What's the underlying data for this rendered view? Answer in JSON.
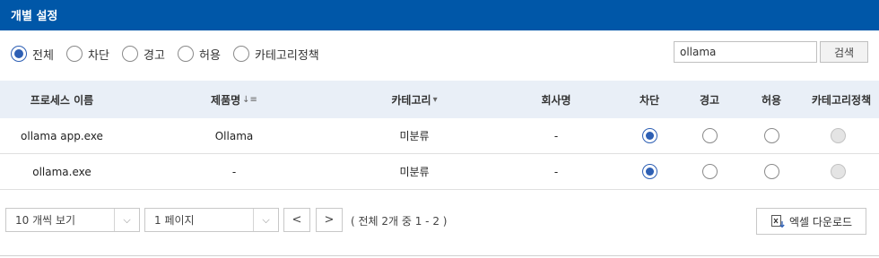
{
  "header": {
    "title": "개별 설정"
  },
  "filters": {
    "options": [
      {
        "label": "전체",
        "checked": true
      },
      {
        "label": "차단",
        "checked": false
      },
      {
        "label": "경고",
        "checked": false
      },
      {
        "label": "허용",
        "checked": false
      },
      {
        "label": "카테고리정책",
        "checked": false
      }
    ],
    "search_value": "ollama",
    "search_button": "검색"
  },
  "table": {
    "columns": [
      "프로세스 이름",
      "제품명",
      "카테고리",
      "회사명",
      "차단",
      "경고",
      "허용",
      "카테고리정책"
    ],
    "sort_icon": "sort-desc-icon",
    "filter_icon": "caret-down-icon",
    "rows": [
      {
        "process": "ollama app.exe",
        "product": "Ollama",
        "category": "미분류",
        "company": "-",
        "selected": "차단"
      },
      {
        "process": "ollama.exe",
        "product": "-",
        "category": "미분류",
        "company": "-",
        "selected": "차단"
      }
    ]
  },
  "footer": {
    "page_size": "10 개씩 보기",
    "page": "1 페이지",
    "prev": "<",
    "next": ">",
    "total": "( 전체 2개 중 1 - 2 )",
    "excel_button": "엑셀 다운로드"
  },
  "colors": {
    "header_bg": "#0057a8",
    "table_header_bg": "#e9eff7",
    "radio_accent": "#2d5fb4"
  }
}
